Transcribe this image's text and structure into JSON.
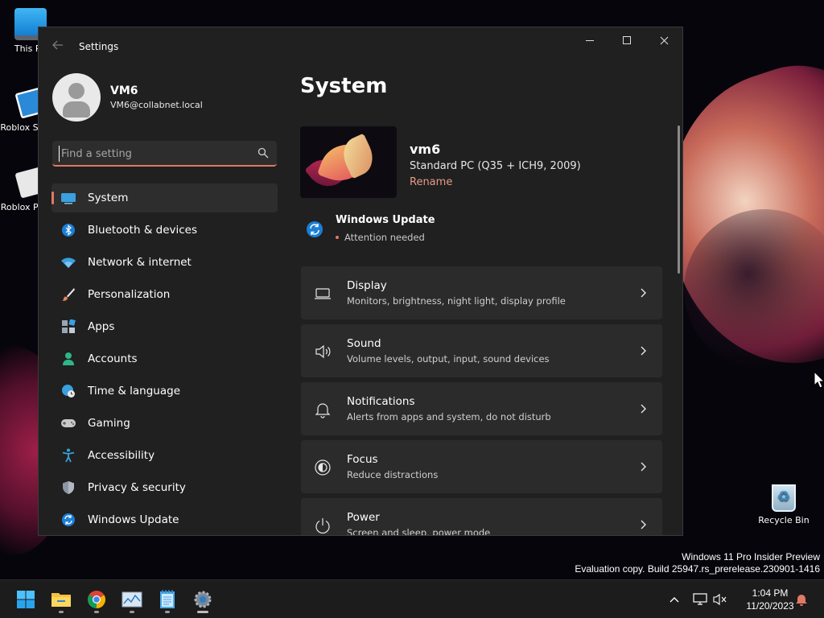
{
  "desktop": {
    "icons": [
      {
        "label": "This PC"
      },
      {
        "label": "Roblox Studio"
      },
      {
        "label": "Roblox Player"
      },
      {
        "label": "Recycle Bin"
      }
    ],
    "watermark": {
      "line1": "Windows 11 Pro Insider Preview",
      "line2": "Evaluation copy. Build 25947.rs_prerelease.230901-1416"
    }
  },
  "window": {
    "title": "Settings",
    "controls": {
      "minimize": "minimize-icon",
      "maximize": "maximize-icon",
      "close": "close-icon"
    }
  },
  "profile": {
    "name": "VM6",
    "email": "VM6@collabnet.local"
  },
  "search": {
    "placeholder": "Find a setting",
    "value": ""
  },
  "nav": {
    "accent": "#e07a65",
    "items": [
      {
        "label": "System",
        "icon": "monitor-icon",
        "selected": true
      },
      {
        "label": "Bluetooth & devices",
        "icon": "bluetooth-icon"
      },
      {
        "label": "Network & internet",
        "icon": "wifi-icon"
      },
      {
        "label": "Personalization",
        "icon": "brush-icon"
      },
      {
        "label": "Apps",
        "icon": "apps-icon"
      },
      {
        "label": "Accounts",
        "icon": "person-icon"
      },
      {
        "label": "Time & language",
        "icon": "globe-clock-icon"
      },
      {
        "label": "Gaming",
        "icon": "gamepad-icon"
      },
      {
        "label": "Accessibility",
        "icon": "accessibility-icon"
      },
      {
        "label": "Privacy & security",
        "icon": "shield-icon"
      },
      {
        "label": "Windows Update",
        "icon": "update-icon"
      }
    ]
  },
  "main": {
    "title": "System",
    "device": {
      "name": "vm6",
      "model": "Standard PC (Q35 + ICH9, 2009)",
      "rename_label": "Rename"
    },
    "windows_update": {
      "title": "Windows Update",
      "status": "Attention needed"
    },
    "cards": [
      {
        "title": "Display",
        "desc": "Monitors, brightness, night light, display profile",
        "icon": "display-icon"
      },
      {
        "title": "Sound",
        "desc": "Volume levels, output, input, sound devices",
        "icon": "speaker-icon"
      },
      {
        "title": "Notifications",
        "desc": "Alerts from apps and system, do not disturb",
        "icon": "bell-icon"
      },
      {
        "title": "Focus",
        "desc": "Reduce distractions",
        "icon": "focus-icon"
      },
      {
        "title": "Power",
        "desc": "Screen and sleep, power mode",
        "icon": "power-icon"
      }
    ]
  },
  "taskbar": {
    "apps": [
      "start-icon",
      "file-explorer-icon",
      "chrome-icon",
      "task-manager-icon",
      "notepad-icon",
      "settings-icon"
    ],
    "clock": {
      "time": "1:04 PM",
      "date": "11/20/2023"
    }
  }
}
